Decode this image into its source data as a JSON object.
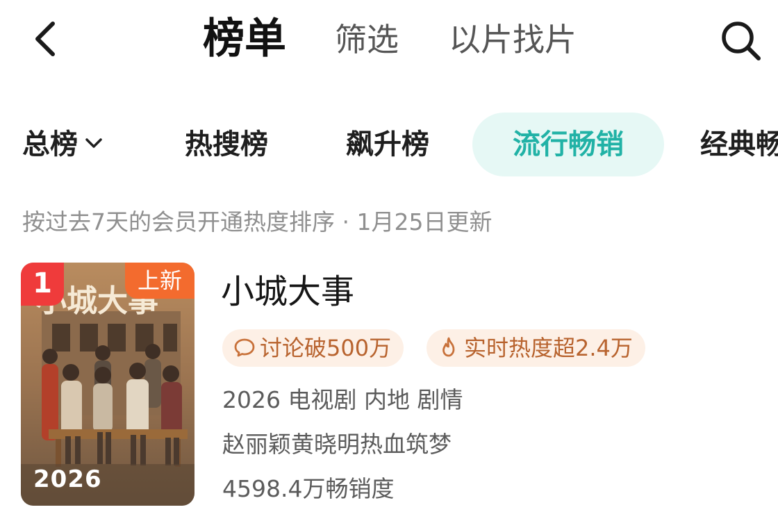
{
  "header": {
    "tabs": [
      {
        "label": "榜单",
        "active": true
      },
      {
        "label": "筛选",
        "active": false
      },
      {
        "label": "以片找片",
        "active": false
      }
    ]
  },
  "icons": {
    "back": "back-arrow-icon",
    "search": "search-icon",
    "dropdown": "chevron-down-icon",
    "discussion": "chat-bubble-icon",
    "heat": "flame-icon"
  },
  "rank_tabs": [
    {
      "label": "总榜",
      "has_dropdown": true
    },
    {
      "label": "热搜榜"
    },
    {
      "label": "飙升榜"
    },
    {
      "label": "流行畅销",
      "selected": true
    },
    {
      "label": "经典畅"
    }
  ],
  "sort_note": "按过去7天的会员开通热度排序 · 1月25日更新",
  "items": [
    {
      "rank": "1",
      "new_badge": "上新",
      "poster_title": "小城大事",
      "poster_year": "2026",
      "title": "小城大事",
      "tags": [
        "讨论破500万",
        "实时热度超2.4万"
      ],
      "info": "2026 电视剧 内地 剧情",
      "description": "赵丽颖黄晓明热血筑梦",
      "sales": "4598.4万畅销度"
    }
  ],
  "colors": {
    "accent": "#21b2a6",
    "accent_bg": "#e6f8f5",
    "rank_badge": "#ef3b3b",
    "new_badge": "#f36b2e",
    "tag_bg": "#fdf0e6",
    "tag_text": "#b8632e"
  }
}
